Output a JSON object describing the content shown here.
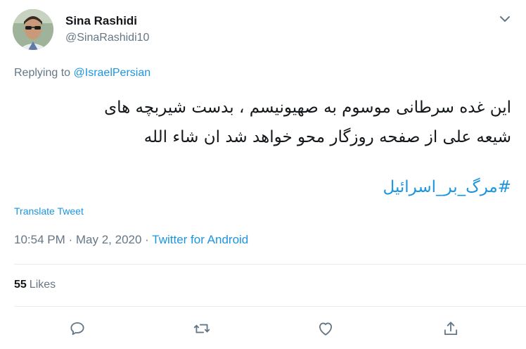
{
  "tweet": {
    "display_name": "Sina Rashidi",
    "handle": "@SinaRashidi10",
    "replying_prefix": "Replying to",
    "replying_to": "@IsraelPersian",
    "text_line1": "این غده سرطانی موسوم به صهیونیسم ، بدست شیربچه های",
    "text_line2": "شیعه علی از صفحه روزگار محو خواهد شد ان شاء الله",
    "hashtag": "#مرگ_بر_اسرائیل",
    "translate_label": "Translate Tweet",
    "timestamp": "10:54 PM · May 2, 2020",
    "separator": " · ",
    "source": "Twitter for Android",
    "likes_count": "55",
    "likes_label": "Likes"
  },
  "icons": {
    "caret": "chevron-down-icon",
    "reply": "reply-icon",
    "retweet": "retweet-icon",
    "like": "heart-icon",
    "share": "share-icon"
  },
  "colors": {
    "link": "#1b95e0",
    "secondary_text": "#657786",
    "primary_text": "#14171a",
    "divider": "#e6ecf0"
  }
}
